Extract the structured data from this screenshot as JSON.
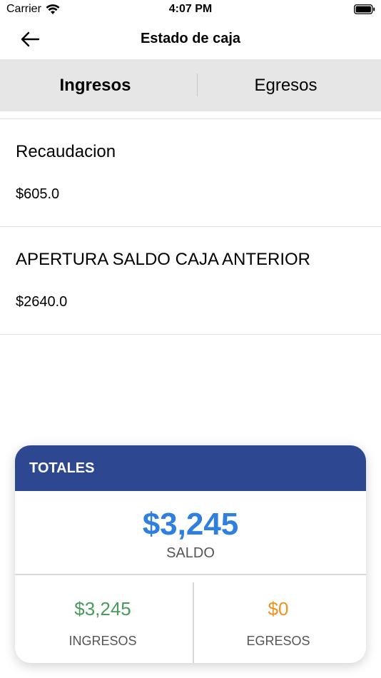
{
  "status_bar": {
    "carrier": "Carrier",
    "time": "4:07 PM"
  },
  "nav": {
    "title": "Estado de caja",
    "back_icon": "arrow-left-icon"
  },
  "tabs": [
    {
      "label": "Ingresos",
      "active": true
    },
    {
      "label": "Egresos",
      "active": false
    }
  ],
  "items": [
    {
      "title": "Recaudacion",
      "amount": "$605.0"
    },
    {
      "title": "APERTURA SALDO CAJA ANTERIOR",
      "amount": "$2640.0"
    }
  ],
  "totals": {
    "header": "TOTALES",
    "saldo_value": "$3,245",
    "saldo_label": "SALDO",
    "ingresos_value": "$3,245",
    "ingresos_label": "INGRESOS",
    "egresos_value": "$0",
    "egresos_label": "EGRESOS"
  },
  "colors": {
    "header_bg": "#2d4890",
    "saldo": "#2e7fe0",
    "ingresos": "#4a9a5c",
    "egresos": "#f0921e"
  }
}
